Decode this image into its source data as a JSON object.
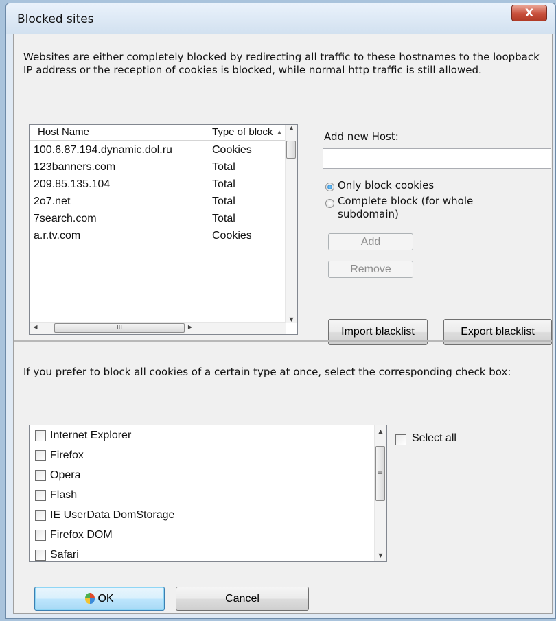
{
  "window": {
    "title": "Blocked sites",
    "close_label": "X"
  },
  "description": "Websites are either completely blocked by redirecting all traffic to these hostnames to the loopback IP address or the reception of cookies is blocked, while normal http traffic is still allowed.",
  "host_list": {
    "columns": [
      "Host Name",
      "Type of block"
    ],
    "rows": [
      {
        "host": "100.6.87.194.dynamic.dol.ru",
        "type": "Cookies"
      },
      {
        "host": "123banners.com",
        "type": "Total"
      },
      {
        "host": "209.85.135.104",
        "type": "Total"
      },
      {
        "host": "2o7.net",
        "type": "Total"
      },
      {
        "host": "7search.com",
        "type": "Total"
      },
      {
        "host": "a.r.tv.com",
        "type": "Cookies"
      }
    ],
    "scroll_up_icon": "up-arrow-icon",
    "scroll_down_icon": "down-arrow-icon",
    "hthumb_grip": "III"
  },
  "add_host": {
    "label": "Add new Host:",
    "value": "",
    "radio_cookies": "Only block cookies",
    "radio_complete": "Complete block (for whole subdomain)",
    "selected": "cookies",
    "add_button": "Add",
    "remove_button": "Remove"
  },
  "import_button": "Import blacklist",
  "export_button": "Export blacklist",
  "cookie_section": {
    "description": "If you prefer to block all cookies of a certain type at once, select the corresponding check box:",
    "items": [
      {
        "label": "Internet Explorer",
        "checked": false
      },
      {
        "label": "Firefox",
        "checked": false
      },
      {
        "label": "Opera",
        "checked": false
      },
      {
        "label": "Flash",
        "checked": false
      },
      {
        "label": "IE UserData DomStorage",
        "checked": false
      },
      {
        "label": "Firefox DOM",
        "checked": false
      },
      {
        "label": "Safari",
        "checked": false
      }
    ],
    "select_all": "Select all",
    "scroll_grip": "≡"
  },
  "footer": {
    "ok": "OK",
    "cancel": "Cancel",
    "ok_icon": "shield-icon"
  }
}
